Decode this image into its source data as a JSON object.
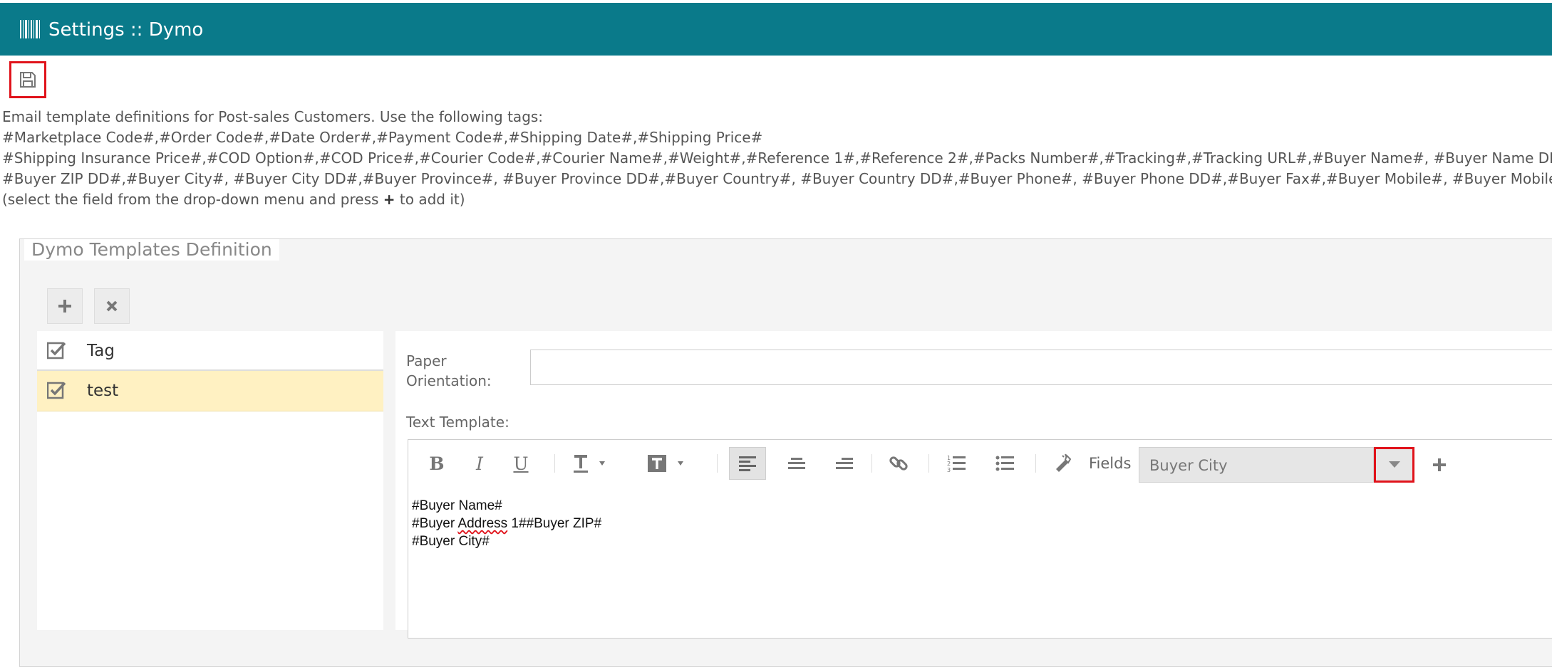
{
  "header": {
    "title": "Settings :: Dymo",
    "icon": "barcode-icon",
    "background": "#0a7a8a"
  },
  "toolbar": {
    "save_icon": "floppy-disk-icon"
  },
  "info": {
    "line1": "Email template definitions for Post-sales Customers. Use the following tags:",
    "line2": "#Marketplace Code#,#Order Code#,#Date Order#,#Payment Code#,#Shipping Date#,#Shipping Price#",
    "line3": "#Shipping Insurance Price#,#COD Option#,#COD Price#,#Courier Code#,#Courier Name#,#Weight#,#Reference 1#,#Reference 2#,#Packs Number#,#Tracking#,#Tracking URL#,#Buyer Name#, #Buyer Name DD#,#Buyer Addr",
    "line4": "#Buyer ZIP DD#,#Buyer City#, #Buyer City DD#,#Buyer Province#, #Buyer Province DD#,#Buyer Country#, #Buyer Country DD#,#Buyer Phone#, #Buyer Phone DD#,#Buyer Fax#,#Buyer Mobile#, #Buyer Mobile DD#,#Buyer Us",
    "line5_prefix": "(select the field from the drop-down menu and press ",
    "line5_plus": "+",
    "line5_suffix": " to add it)"
  },
  "panel": {
    "legend": "Dymo Templates Definition",
    "add_icon": "plus-icon",
    "delete_icon": "close-icon"
  },
  "tag_table": {
    "header": "Tag",
    "rows": [
      {
        "label": "test",
        "selected": true
      }
    ]
  },
  "form": {
    "paper_label_1": "Paper",
    "paper_label_2": "Orientation:",
    "paper_value": "",
    "text_template_label": "Text Template:",
    "fields_label": "Fields",
    "fields_value": "Buyer City",
    "editor_lines": {
      "l1": "#Buyer Name#",
      "l2_a": "#Buyer ",
      "l2_b": "Address",
      "l2_c": " 1##Buyer ZIP#",
      "l3": "#Buyer City#"
    }
  },
  "editor_toolbar": {
    "bold": "B",
    "italic": "I",
    "underline": "U",
    "icons": [
      "bold-icon",
      "italic-icon",
      "underline-icon",
      "font-color-icon",
      "background-color-icon",
      "align-left-icon",
      "align-center-icon",
      "align-right-icon",
      "link-icon",
      "ordered-list-icon",
      "unordered-list-icon",
      "clear-format-icon",
      "dropdown-arrow-icon",
      "add-field-icon"
    ]
  },
  "colors": {
    "accent": "#0a7a8a",
    "highlight_box": "#e0131b",
    "selected_row": "#fff1c2"
  }
}
